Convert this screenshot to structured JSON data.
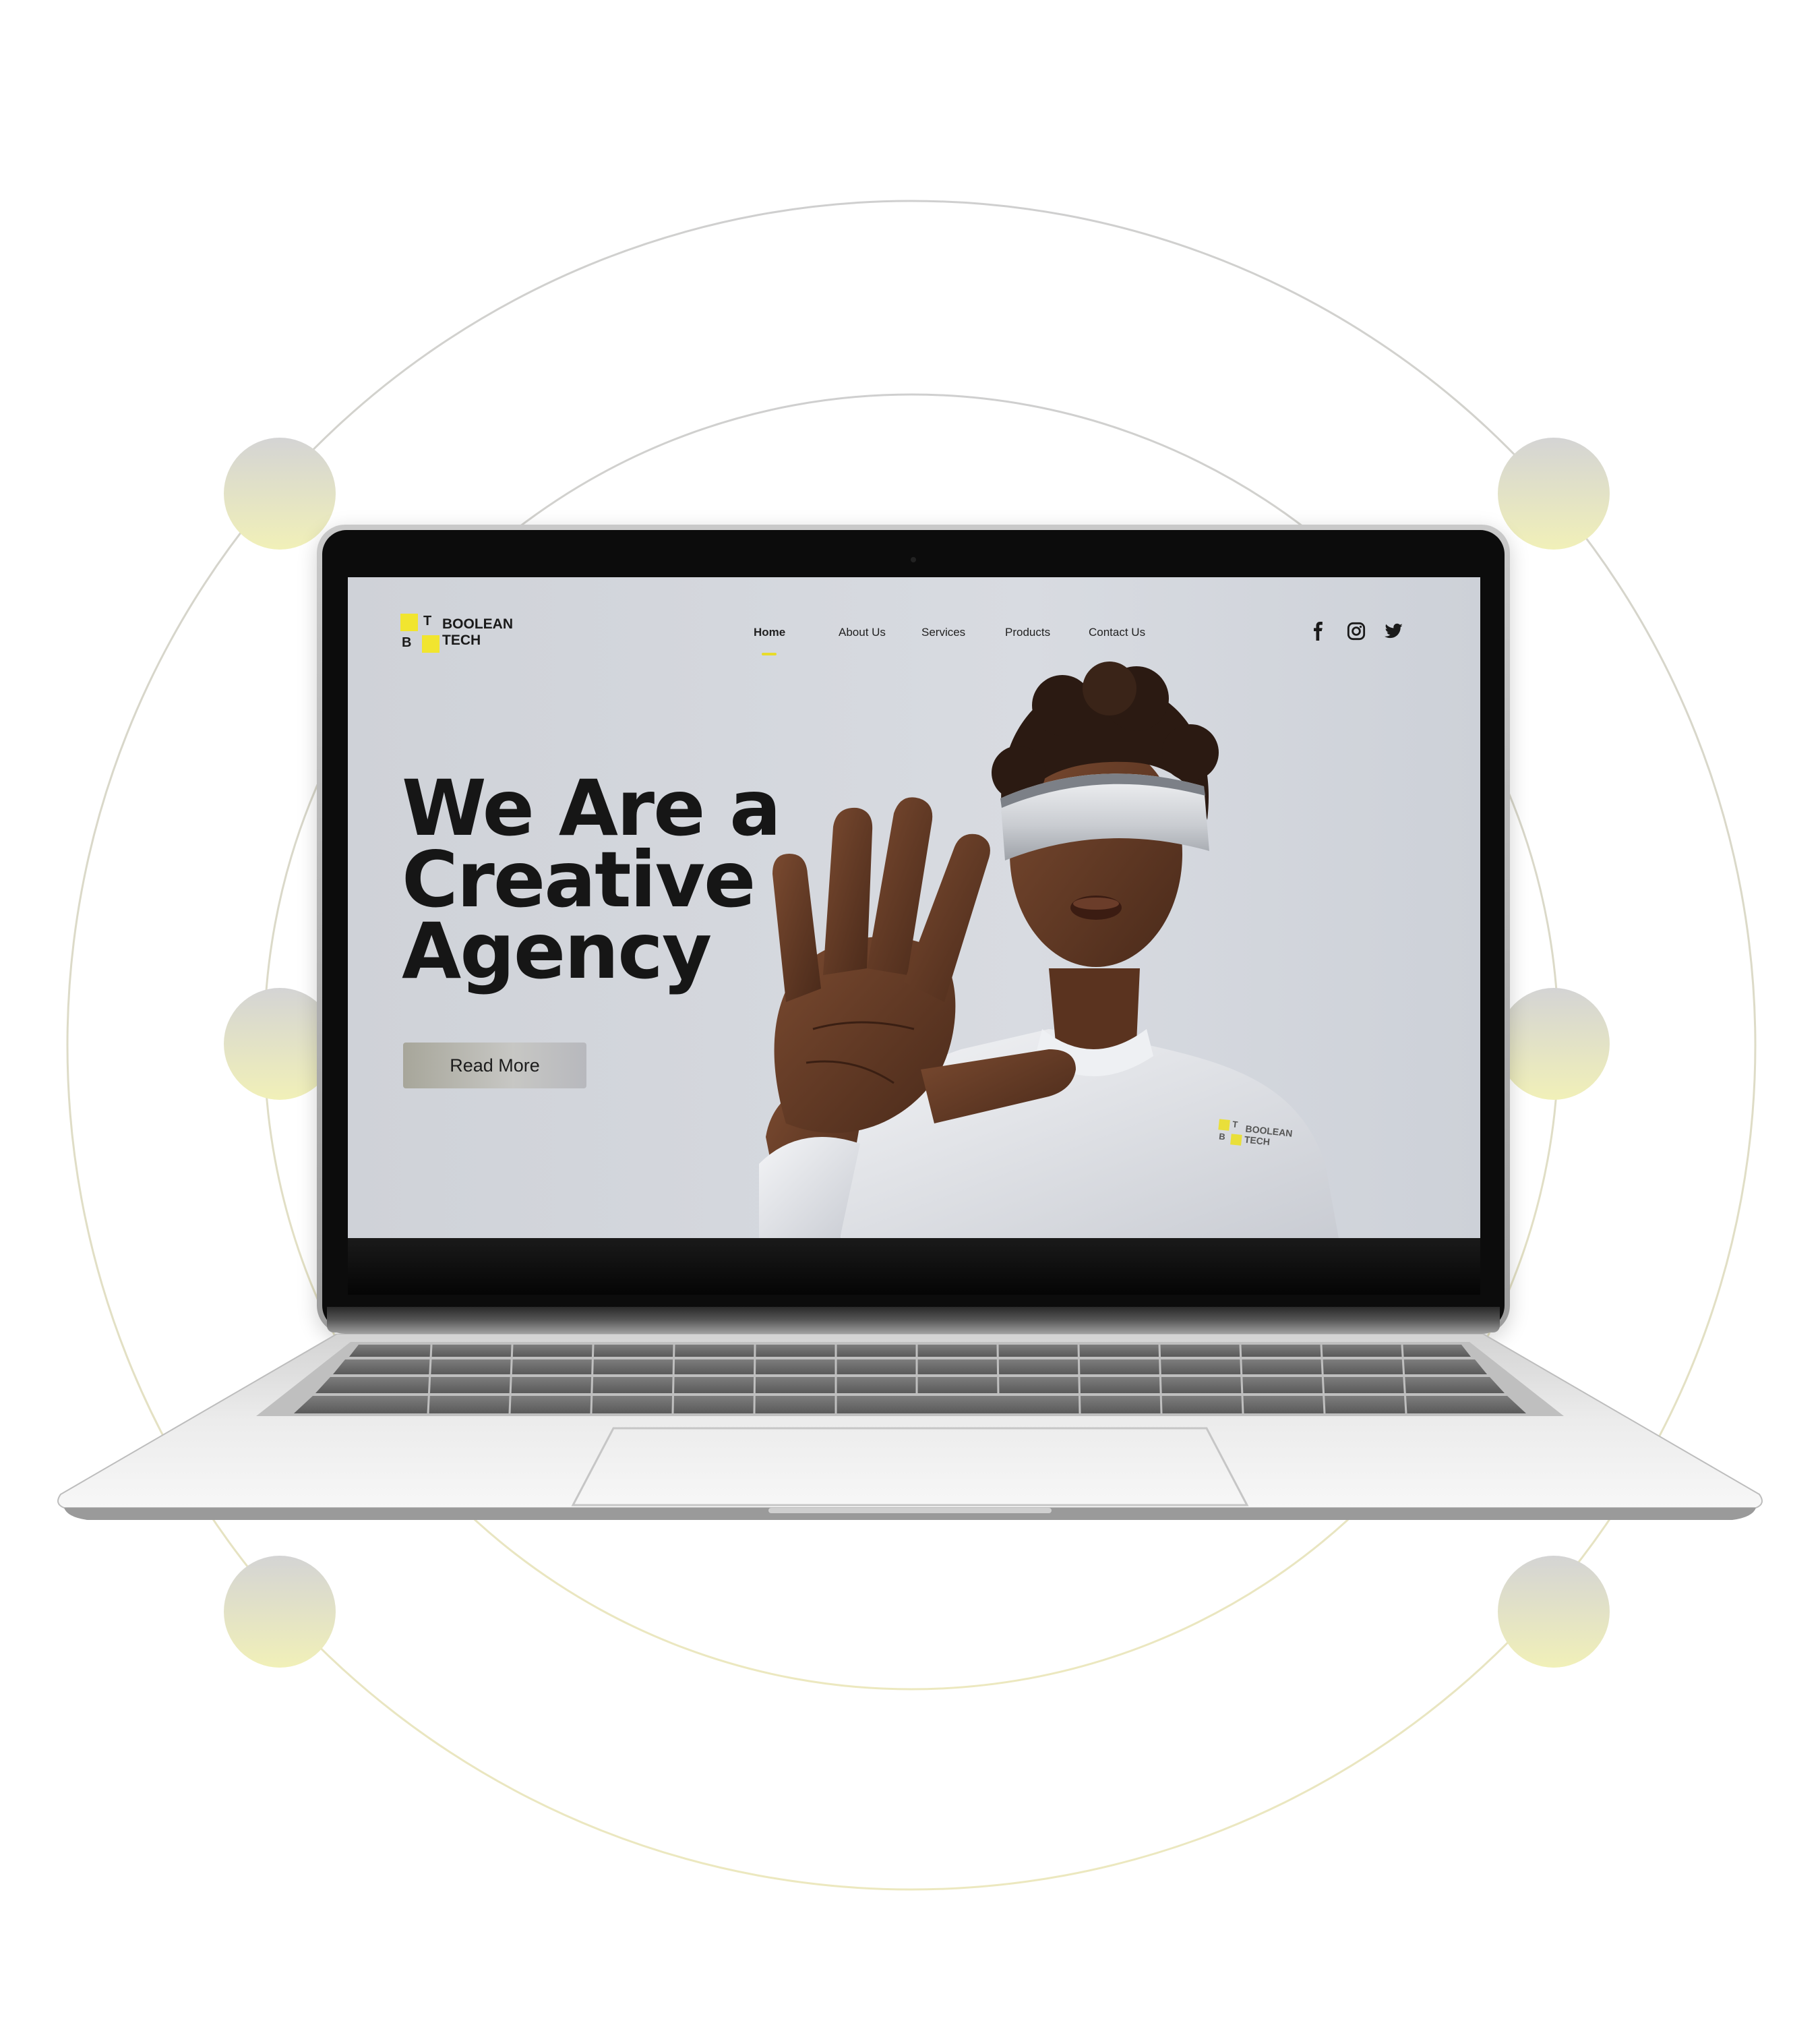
{
  "website": {
    "brand": {
      "letter_top": "T",
      "letter_bottom": "B",
      "word1": "BOOLEAN",
      "word2": "TECH",
      "accent_color": "#f1e52f"
    },
    "nav": {
      "items": [
        {
          "label": "Home",
          "active": true
        },
        {
          "label": "About Us",
          "active": false
        },
        {
          "label": "Services",
          "active": false
        },
        {
          "label": "Products",
          "active": false
        },
        {
          "label": "Contact Us",
          "active": false
        }
      ]
    },
    "social": [
      {
        "icon": "facebook-icon"
      },
      {
        "icon": "instagram-icon"
      },
      {
        "icon": "twitter-icon"
      }
    ],
    "hero": {
      "title_line1": "We Are a",
      "title_line2": "Creative",
      "title_line3": "Agency",
      "button_label": "Read More"
    },
    "shirt_logo": {
      "letter_top": "T",
      "letter_bottom": "B",
      "word1": "BOOLEAN",
      "word2": "TECH"
    }
  },
  "colors": {
    "page_background": "#ffffff",
    "screen_background": "#d6d9de",
    "decor_circle": "#e6e3b3"
  }
}
